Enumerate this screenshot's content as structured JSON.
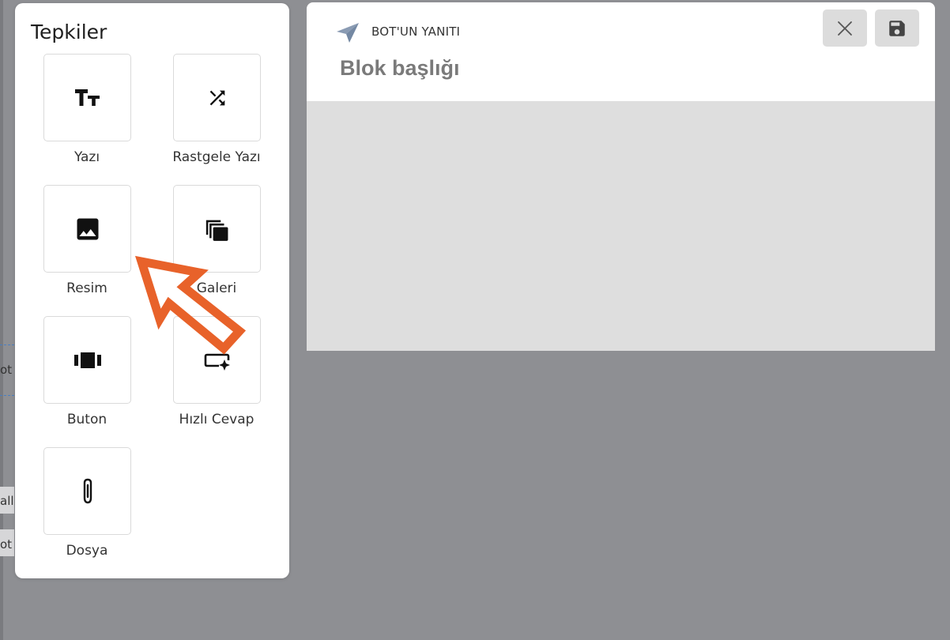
{
  "panel": {
    "title": "Tepkiler",
    "items": [
      {
        "label": "Yazı",
        "icon": "text-format-icon"
      },
      {
        "label": "Rastgele Yazı",
        "icon": "shuffle-icon"
      },
      {
        "label": "Resim",
        "icon": "image-icon"
      },
      {
        "label": "Galeri",
        "icon": "gallery-icon"
      },
      {
        "label": "Buton",
        "icon": "button-carousel-icon"
      },
      {
        "label": "Hızlı Cevap",
        "icon": "quick-reply-icon"
      },
      {
        "label": "Dosya",
        "icon": "paperclip-icon"
      }
    ]
  },
  "card": {
    "label": "BOT'UN YANITI",
    "heading": "Blok başlığı",
    "close_icon": "close-icon",
    "save_icon": "save-icon"
  },
  "background": {
    "fragment_1": "ot",
    "fragment_2": "all",
    "fragment_3": "ot"
  },
  "colors": {
    "overlay": "#8e8f93",
    "panel": "#ffffff",
    "card_body": "#dedede",
    "pointer_arrow": "#e8622a",
    "send_icon": "#8a9bb3"
  }
}
